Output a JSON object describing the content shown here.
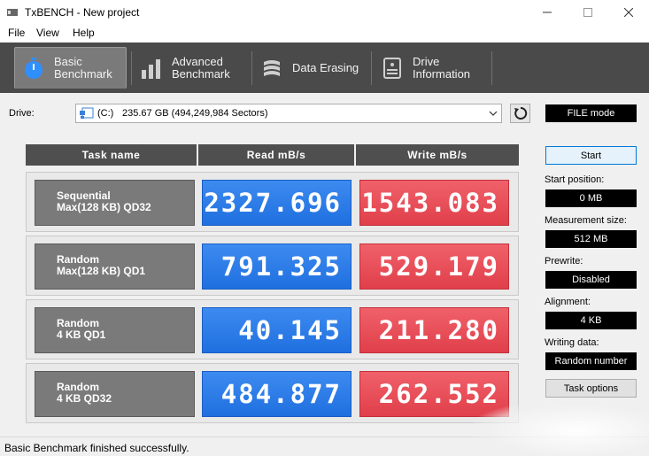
{
  "window": {
    "title": "TxBENCH - New project"
  },
  "menu": [
    "File",
    "View",
    "Help"
  ],
  "tabs": [
    {
      "line1": "Basic",
      "line2": "Benchmark",
      "icon": "stopwatch-icon",
      "active": true
    },
    {
      "line1": "Advanced",
      "line2": "Benchmark",
      "icon": "bar-chart-icon",
      "active": false
    },
    {
      "line1": "Data Erasing",
      "line2": "",
      "icon": "eraser-icon",
      "active": false
    },
    {
      "line1": "Drive",
      "line2": "Information",
      "icon": "drive-info-icon",
      "active": false
    }
  ],
  "drive": {
    "label": "Drive:",
    "letter": "(C:)",
    "size": "235.67 GB (494,249,984 Sectors)"
  },
  "mode": "FILE mode",
  "headers": {
    "task": "Task name",
    "read": "Read mB/s",
    "write": "Write mB/s"
  },
  "results": [
    {
      "line1": "Sequential",
      "line2": "Max(128 KB) QD32",
      "read": "2327.696",
      "write": "1543.083"
    },
    {
      "line1": "Random",
      "line2": "Max(128 KB) QD1",
      "read": "791.325",
      "write": "529.179"
    },
    {
      "line1": "Random",
      "line2": "4 KB QD1",
      "read": "40.145",
      "write": "211.280"
    },
    {
      "line1": "Random",
      "line2": "4 KB QD32",
      "read": "484.877",
      "write": "262.552"
    }
  ],
  "side": {
    "start_label": "Start",
    "start_position_label": "Start position:",
    "start_position": "0 MB",
    "measurement_size_label": "Measurement size:",
    "measurement_size": "512 MB",
    "prewrite_label": "Prewrite:",
    "prewrite": "Disabled",
    "alignment_label": "Alignment:",
    "alignment": "4 KB",
    "writing_data_label": "Writing data:",
    "writing_data": "Random number",
    "task_options_label": "Task options"
  },
  "status": "Basic Benchmark finished successfully.",
  "colors": {
    "read": "#2a7ae8",
    "write": "#e8505a",
    "tabbar": "#4a4a4a"
  }
}
